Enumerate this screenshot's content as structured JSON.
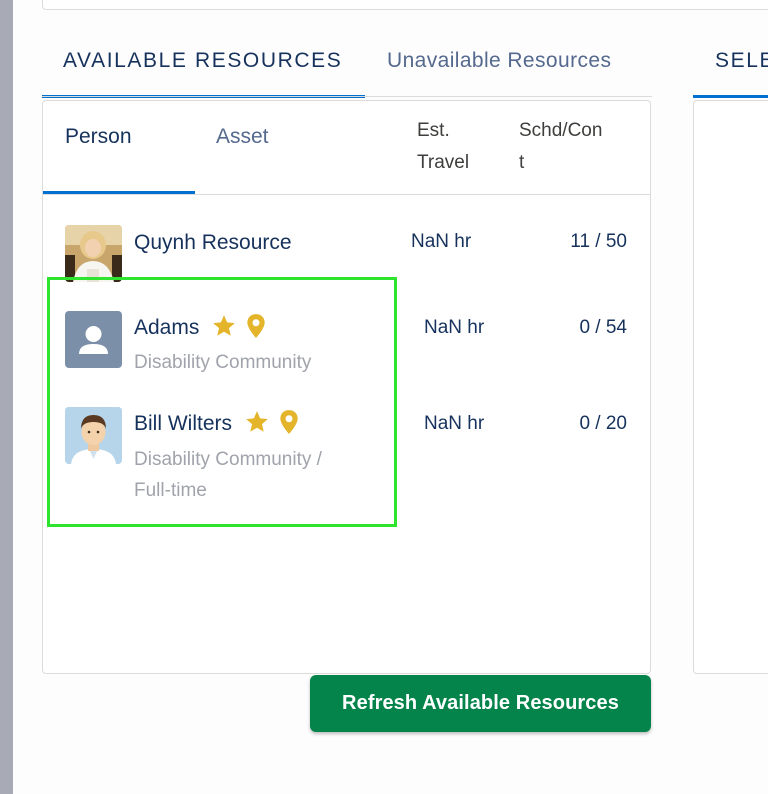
{
  "tabs": {
    "available": "AVAILABLE RESOURCES",
    "unavailable": "Unavailable Resources",
    "selected": "SELE"
  },
  "sub_tabs": {
    "person": "Person",
    "asset": "Asset"
  },
  "columns": {
    "travel_line1": "Est.",
    "travel_line2": "Travel",
    "schd_line1": "Schd/Con",
    "schd_line2": "t"
  },
  "resources": [
    {
      "name": "Quynh Resource",
      "subtitle_line1": "",
      "subtitle_line2": "",
      "travel": "NaN hr",
      "schd": "11 / 50",
      "avatar": "photo-avatar",
      "icons": []
    },
    {
      "name": "Adams",
      "subtitle_line1": "Disability Community",
      "subtitle_line2": "",
      "travel": "NaN hr",
      "schd": "0 / 54",
      "avatar": "generic-user-avatar",
      "icons": [
        "star-icon",
        "location-pin-icon"
      ]
    },
    {
      "name": "Bill Wilters",
      "subtitle_line1": "Disability Community /",
      "subtitle_line2": "Full-time",
      "travel": "NaN hr",
      "schd": "0 / 20",
      "avatar": "cartoon-man-avatar",
      "icons": [
        "star-icon",
        "location-pin-icon"
      ]
    }
  ],
  "refresh_button": "Refresh Available Resources",
  "colors": {
    "accent_blue": "#0070d2",
    "button_green": "#04844b",
    "star_gold": "#e4b52a",
    "highlight_green": "#2ee42e",
    "text_dark": "#16325c",
    "text_muted": "#a0a3ab"
  }
}
